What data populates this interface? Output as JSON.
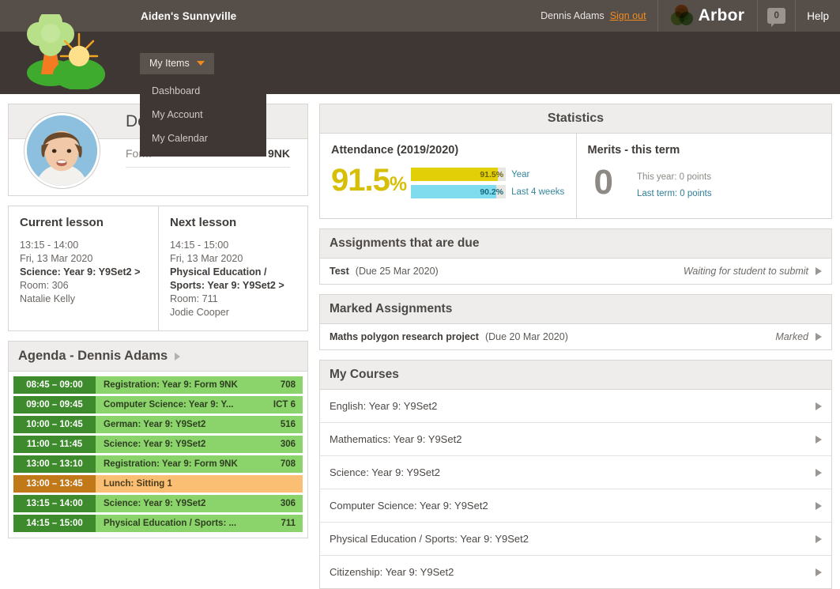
{
  "header": {
    "school_name": "Aiden's Sunnyville",
    "user_name": "Dennis Adams",
    "sign_out_label": "Sign out",
    "brand_name": "Arbor",
    "notification_count": "0",
    "help_label": "Help"
  },
  "nav": {
    "menu_label": "My Items",
    "dropdown_items": [
      {
        "label": "Dashboard"
      },
      {
        "label": "My Account"
      },
      {
        "label": "My Calendar"
      }
    ]
  },
  "profile": {
    "name": "Den",
    "form_label": "Form",
    "form_value": "9NK"
  },
  "lessons": [
    {
      "title": "Current lesson",
      "time": "13:15 - 14:00",
      "date": "Fri, 13 Mar 2020",
      "course": "Science: Year 9: Y9Set2 >",
      "room": "Room: 306",
      "teacher": "Natalie Kelly"
    },
    {
      "title": "Next lesson",
      "time": "14:15 - 15:00",
      "date": "Fri, 13 Mar 2020",
      "course": "Physical Education / Sports: Year 9: Y9Set2 >",
      "room": "Room: 711",
      "teacher": "Jodie Cooper"
    }
  ],
  "agenda": {
    "title": "Agenda - Dennis Adams",
    "rows": [
      {
        "time": "08:45 – 09:00",
        "label": "Registration: Year 9: Form 9NK",
        "room": "708",
        "type": "lesson"
      },
      {
        "time": "09:00 – 09:45",
        "label": "Computer Science: Year 9: Y...",
        "room": "ICT 6",
        "type": "lesson"
      },
      {
        "time": "10:00 – 10:45",
        "label": "German: Year 9: Y9Set2",
        "room": "516",
        "type": "lesson"
      },
      {
        "time": "11:00 – 11:45",
        "label": "Science: Year 9: Y9Set2",
        "room": "306",
        "type": "lesson"
      },
      {
        "time": "13:00 – 13:10",
        "label": "Registration: Year 9: Form 9NK",
        "room": "708",
        "type": "lesson"
      },
      {
        "time": "13:00 – 13:45",
        "label": "Lunch: Sitting 1",
        "room": "",
        "type": "lunch"
      },
      {
        "time": "13:15 – 14:00",
        "label": "Science: Year 9: Y9Set2",
        "room": "306",
        "type": "lesson"
      },
      {
        "time": "14:15 – 15:00",
        "label": "Physical Education / Sports: ...",
        "room": "711",
        "type": "lesson"
      }
    ]
  },
  "statistics": {
    "title": "Statistics",
    "attendance": {
      "title": "Attendance (2019/2020)",
      "headline": "91.5",
      "headline_unit": "%",
      "bars": [
        {
          "value_label": "91.5%",
          "percent": 91.5,
          "legend": "Year",
          "color": "#e3cf08"
        },
        {
          "value_label": "90.2%",
          "percent": 90.2,
          "legend": "Last 4 weeks",
          "color": "#7fdcee"
        }
      ]
    },
    "merits": {
      "title": "Merits - this term",
      "headline": "0",
      "this_year": "This year: 0 points",
      "last_term": "Last term: 0 points"
    }
  },
  "assignments_due": {
    "title": "Assignments that are due",
    "rows": [
      {
        "name": "Test",
        "due": "(Due 25 Mar 2020)",
        "status": "Waiting for student to submit"
      }
    ]
  },
  "marked_assignments": {
    "title": "Marked Assignments",
    "rows": [
      {
        "name": "Maths polygon research project",
        "due": "(Due 20 Mar 2020)",
        "status": "Marked"
      }
    ]
  },
  "my_courses": {
    "title": "My Courses",
    "rows": [
      {
        "label": "English: Year 9: Y9Set2"
      },
      {
        "label": "Mathematics: Year 9: Y9Set2"
      },
      {
        "label": "Science: Year 9: Y9Set2"
      },
      {
        "label": "Computer Science: Year 9: Y9Set2"
      },
      {
        "label": "Physical Education / Sports: Year 9: Y9Set2"
      },
      {
        "label": "Citizenship: Year 9: Y9Set2"
      }
    ]
  },
  "colors": {
    "header_bar": "#564e49",
    "nav_bar": "#3e3733",
    "accent_orange": "#f08a1e",
    "lesson_green": "#8ad46b",
    "lunch_orange": "#fabf72",
    "attendance_yellow": "#d6bf06"
  }
}
